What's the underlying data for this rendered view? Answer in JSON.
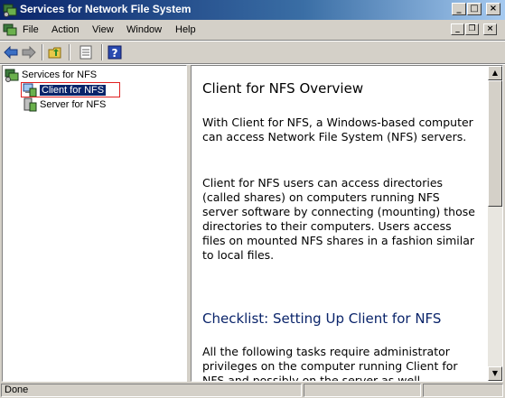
{
  "window": {
    "title": "Services for Network File System"
  },
  "menubar": {
    "items": [
      "File",
      "Action",
      "View",
      "Window",
      "Help"
    ]
  },
  "toolbar": {
    "buttons": [
      "back-icon",
      "forward-icon",
      "up-folder-icon",
      "properties-icon",
      "help-icon"
    ]
  },
  "tree": {
    "root": "Services for NFS",
    "children": [
      "Client for NFS",
      "Server for NFS"
    ],
    "selected_index": 0
  },
  "content": {
    "heading": "Client for NFS Overview",
    "para1": "With Client for NFS, a Windows-based computer can access Network File System (NFS) servers.",
    "para2": "Client for NFS users can access directories (called shares) on computers running NFS server software by connecting (mounting) those directories to their computers.  Users access files on mounted NFS shares in a fashion similar to local files.",
    "checklist_heading": "Checklist: Setting Up Client for NFS",
    "para3": "All the following tasks require administrator privileges on the computer running Client for NFS and possibly on the server as well."
  },
  "statusbar": {
    "text": "Done"
  },
  "colors": {
    "title_gradient_start": "#0a246a",
    "title_gradient_end": "#a6caf0",
    "selection": "#0a246a",
    "highlight_box": "#e02020",
    "link_heading": "#0a246a"
  }
}
